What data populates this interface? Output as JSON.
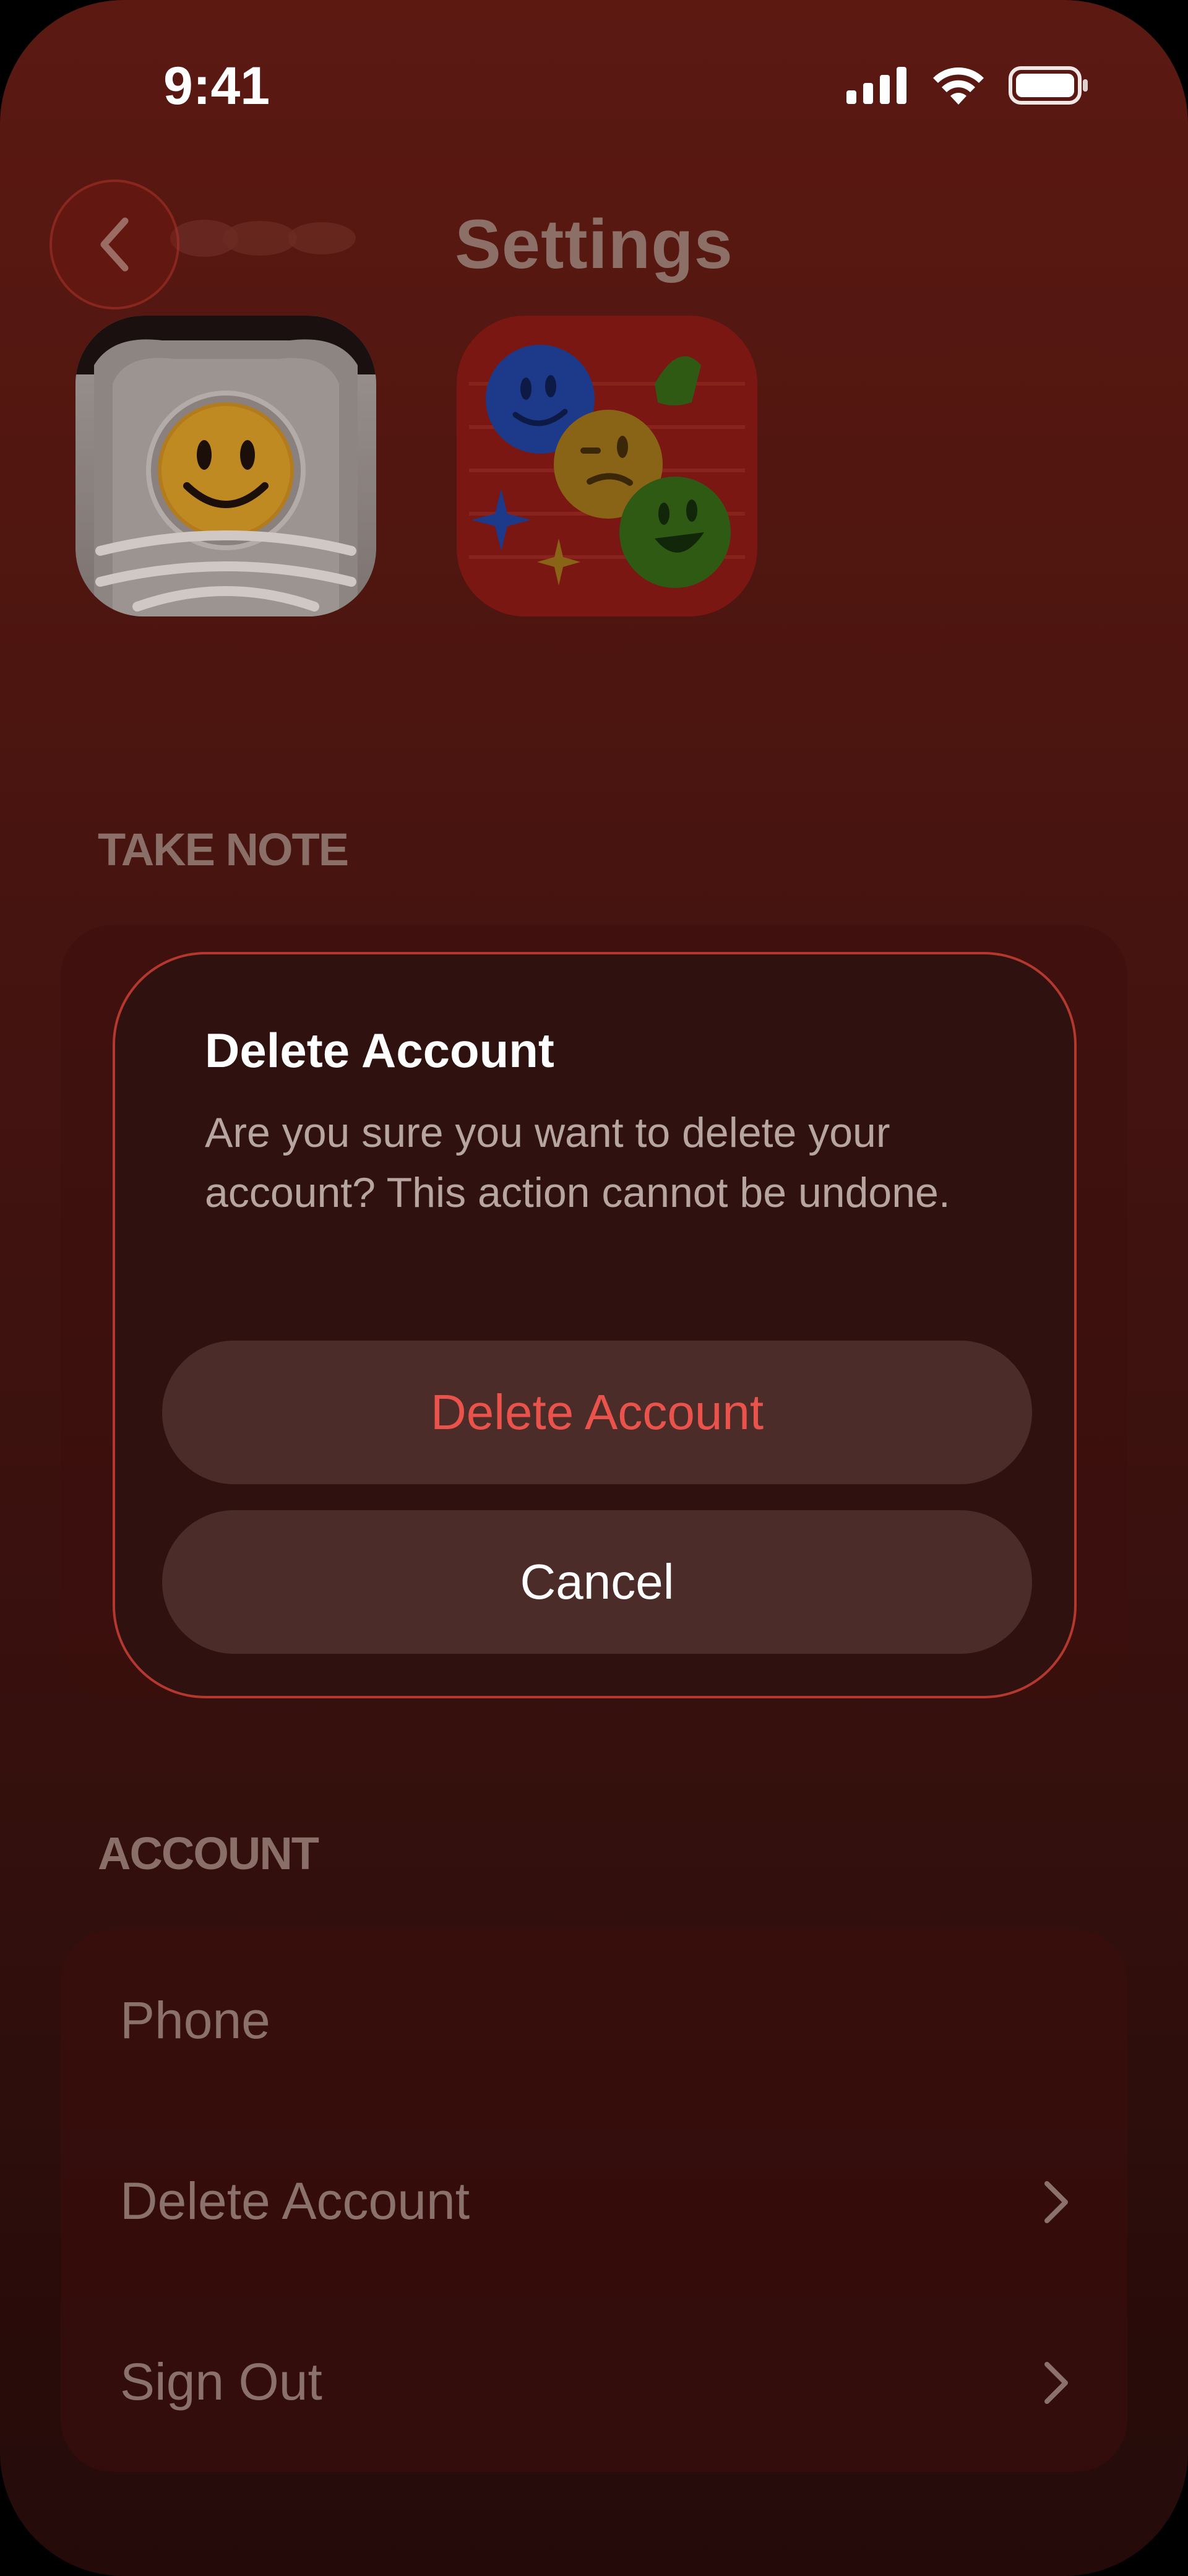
{
  "status_bar": {
    "time": "9:41"
  },
  "header": {
    "title": "Settings",
    "back_icon": "chevron-left-icon"
  },
  "sections": {
    "take_note": {
      "title": "TAKE NOTE"
    },
    "account": {
      "title": "ACCOUNT",
      "items": [
        {
          "label": "Phone"
        },
        {
          "label": "Delete Account"
        },
        {
          "label": "Sign Out"
        }
      ]
    }
  },
  "dialog": {
    "title": "Delete Account",
    "message": "Are you sure you want to delete your account? This action cannot be undone.",
    "confirm_label": "Delete Account",
    "cancel_label": "Cancel"
  },
  "colors": {
    "background_top": "#5b1912",
    "background_bottom": "#240b09",
    "dialog_border": "#d64236",
    "destructive": "#ea524c"
  }
}
